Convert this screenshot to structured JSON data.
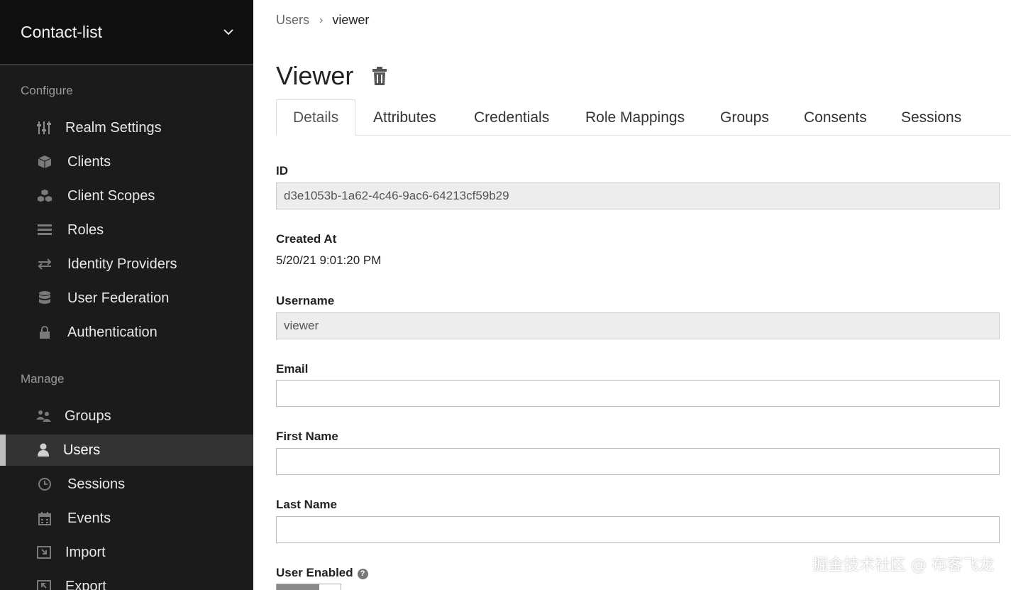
{
  "sidebar": {
    "realm_name": "Contact-list",
    "configure_label": "Configure",
    "manage_label": "Manage",
    "configure_items": [
      {
        "label": "Realm Settings",
        "icon": "sliders-icon"
      },
      {
        "label": "Clients",
        "icon": "cube-icon"
      },
      {
        "label": "Client Scopes",
        "icon": "cubes-icon"
      },
      {
        "label": "Roles",
        "icon": "list-icon"
      },
      {
        "label": "Identity Providers",
        "icon": "exchange-icon"
      },
      {
        "label": "User Federation",
        "icon": "database-icon"
      },
      {
        "label": "Authentication",
        "icon": "lock-icon"
      }
    ],
    "manage_items": [
      {
        "label": "Groups",
        "icon": "users-icon"
      },
      {
        "label": "Users",
        "icon": "user-icon",
        "active": true
      },
      {
        "label": "Sessions",
        "icon": "clock-icon"
      },
      {
        "label": "Events",
        "icon": "calendar-icon"
      },
      {
        "label": "Import",
        "icon": "import-icon"
      },
      {
        "label": "Export",
        "icon": "export-icon"
      }
    ]
  },
  "breadcrumb": {
    "parent": "Users",
    "separator": "›",
    "current": "viewer"
  },
  "page": {
    "title": "Viewer"
  },
  "tabs": [
    {
      "label": "Details",
      "active": true
    },
    {
      "label": "Attributes"
    },
    {
      "label": "Credentials"
    },
    {
      "label": "Role Mappings"
    },
    {
      "label": "Groups"
    },
    {
      "label": "Consents"
    },
    {
      "label": "Sessions"
    }
  ],
  "form": {
    "id_label": "ID",
    "id_value": "d3e1053b-1a62-4c46-9ac6-64213cf59b29",
    "created_label": "Created At",
    "created_value": "5/20/21 9:01:20 PM",
    "username_label": "Username",
    "username_value": "viewer",
    "email_label": "Email",
    "email_value": "",
    "first_name_label": "First Name",
    "first_name_value": "",
    "last_name_label": "Last Name",
    "last_name_value": "",
    "user_enabled_label": "User Enabled",
    "user_enabled_value": true
  },
  "watermark": "掘金技术社区 @ 布客飞龙"
}
